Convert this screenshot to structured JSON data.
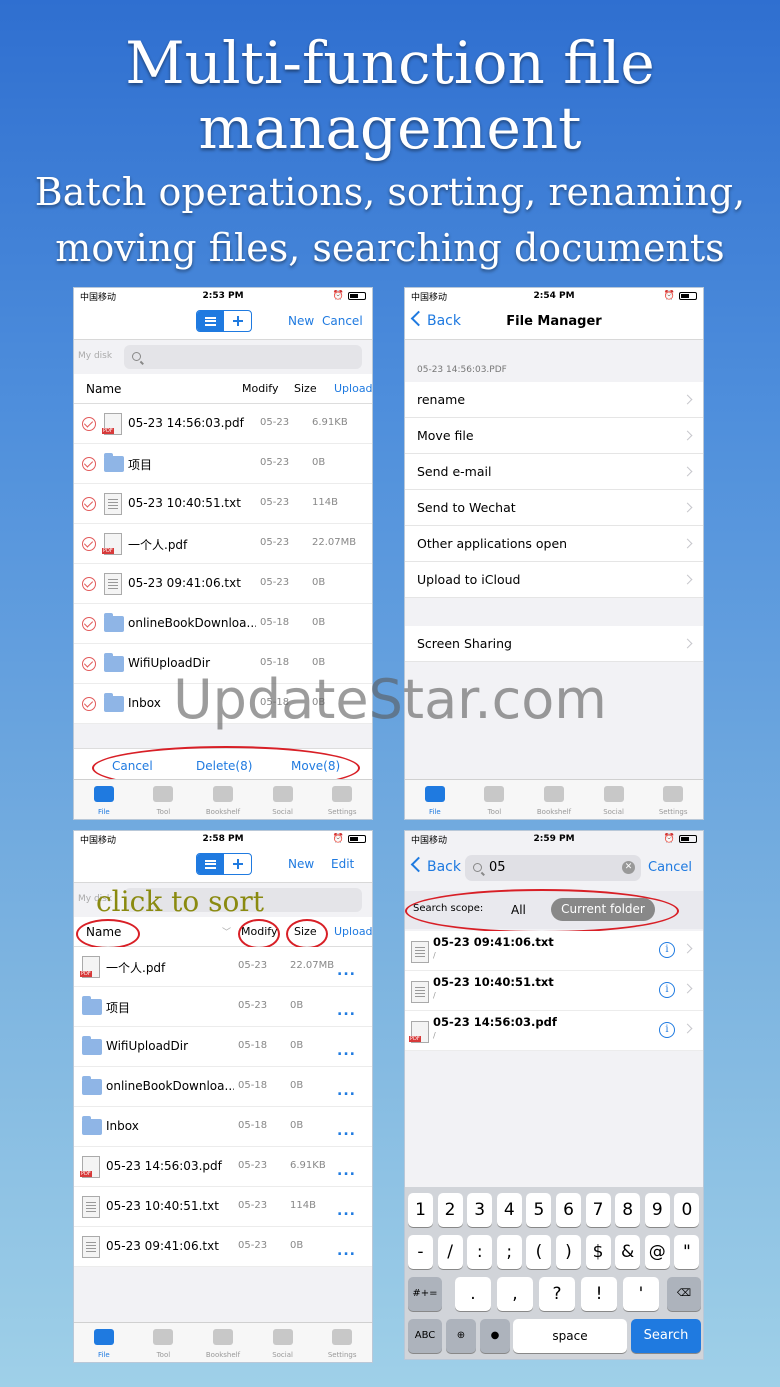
{
  "hero": {
    "line1": "Multi-function file",
    "line2": "management",
    "line3": "Batch operations, sorting, renaming,",
    "line4": "moving files, searching documents"
  },
  "watermark": "UpdateStar.com",
  "status": {
    "carrier": "中国移动",
    "signal_icon": "wifi-icon",
    "times": [
      "2:53 PM",
      "2:54 PM",
      "2:58 PM",
      "2:59 PM"
    ]
  },
  "tabbar": [
    "File",
    "Tool",
    "Bookshelf",
    "Social",
    "Settings"
  ],
  "s1": {
    "new": "New",
    "cancel": "Cancel",
    "mydisk": "My disk",
    "cols": {
      "name": "Name",
      "modify": "Modify",
      "size": "Size",
      "upload": "Upload"
    },
    "rows": [
      {
        "name": "05-23 14:56:03.pdf",
        "date": "05-23",
        "size": "6.91KB",
        "type": "pdf"
      },
      {
        "name": "项目",
        "date": "05-23",
        "size": "0B",
        "type": "folder"
      },
      {
        "name": "05-23 10:40:51.txt",
        "date": "05-23",
        "size": "114B",
        "type": "txt"
      },
      {
        "name": "一个人.pdf",
        "date": "05-23",
        "size": "22.07MB",
        "type": "pdf"
      },
      {
        "name": "05-23 09:41:06.txt",
        "date": "05-23",
        "size": "0B",
        "type": "txt"
      },
      {
        "name": "onlineBookDownloa...",
        "date": "05-18",
        "size": "0B",
        "type": "folder"
      },
      {
        "name": "WifiUploadDir",
        "date": "05-18",
        "size": "0B",
        "type": "folder"
      },
      {
        "name": "Inbox",
        "date": "05-18",
        "size": "0B",
        "type": "folder"
      }
    ],
    "actions": {
      "cancel": "Cancel",
      "delete": "Delete(8)",
      "move": "Move(8)"
    }
  },
  "s2": {
    "back": "Back",
    "title": "File Manager",
    "file": "05-23 14:56:03.PDF",
    "menu": [
      "rename",
      "Move file",
      "Send e-mail",
      "Send to Wechat",
      "Other applications open",
      "Upload to iCloud"
    ],
    "menu2": [
      "Screen Sharing"
    ]
  },
  "s3": {
    "new": "New",
    "edit": "Edit",
    "mydisk": "My disk",
    "annotation": "click to sort",
    "cols": {
      "name": "Name",
      "modify": "Modify",
      "size": "Size",
      "upload": "Upload"
    },
    "rows": [
      {
        "name": "一个人.pdf",
        "date": "05-23",
        "size": "22.07MB",
        "type": "pdf"
      },
      {
        "name": "项目",
        "date": "05-23",
        "size": "0B",
        "type": "folder"
      },
      {
        "name": "WifiUploadDir",
        "date": "05-18",
        "size": "0B",
        "type": "folder"
      },
      {
        "name": "onlineBookDownloa...",
        "date": "05-18",
        "size": "0B",
        "type": "folder"
      },
      {
        "name": "Inbox",
        "date": "05-18",
        "size": "0B",
        "type": "folder"
      },
      {
        "name": "05-23 14:56:03.pdf",
        "date": "05-23",
        "size": "6.91KB",
        "type": "pdf"
      },
      {
        "name": "05-23 10:40:51.txt",
        "date": "05-23",
        "size": "114B",
        "type": "txt"
      },
      {
        "name": "05-23 09:41:06.txt",
        "date": "05-23",
        "size": "0B",
        "type": "txt"
      }
    ],
    "more": "..."
  },
  "s4": {
    "back": "Back",
    "query": "05",
    "cancel": "Cancel",
    "scope_label": "Search scope:",
    "scope_all": "All",
    "scope_current": "Current folder",
    "results": [
      {
        "name": "05-23 09:41:06.txt",
        "path": "/",
        "type": "txt"
      },
      {
        "name": "05-23 10:40:51.txt",
        "path": "/",
        "type": "txt"
      },
      {
        "name": "05-23 14:56:03.pdf",
        "path": "/",
        "type": "pdf"
      }
    ],
    "keys1": [
      "1",
      "2",
      "3",
      "4",
      "5",
      "6",
      "7",
      "8",
      "9",
      "0"
    ],
    "keys2": [
      "-",
      "/",
      ":",
      ";",
      "(",
      ")",
      "$",
      "&",
      "@",
      "\""
    ],
    "keys3": [
      ".",
      ",",
      "?",
      "!",
      "'"
    ],
    "key_sym": "#+=",
    "key_abc": "ABC",
    "key_space": "space",
    "key_search": "Search"
  }
}
